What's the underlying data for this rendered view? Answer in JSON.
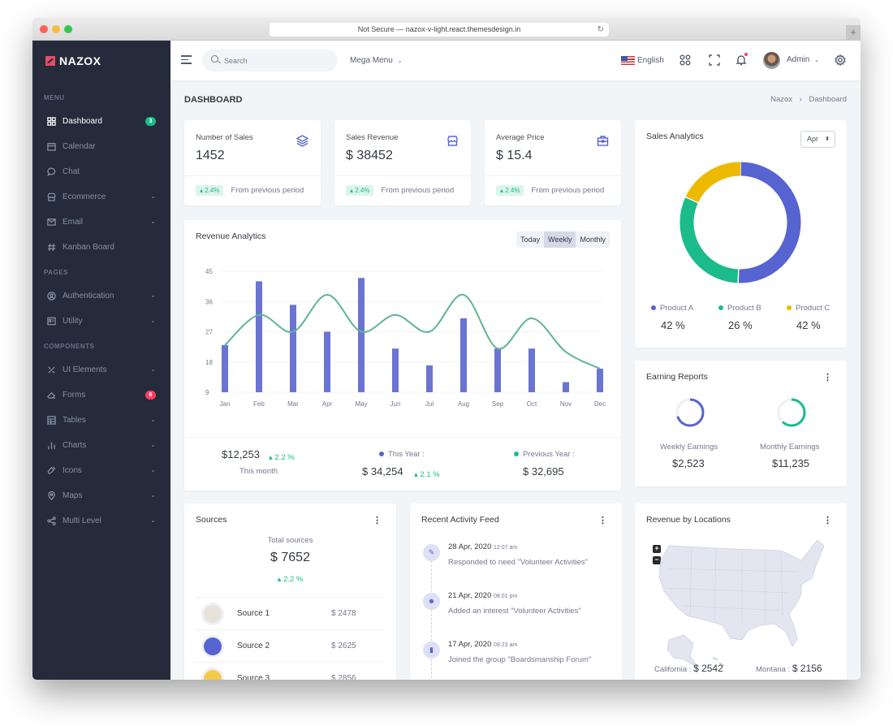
{
  "browser": {
    "url_text": "Not Secure — nazox-v-light.react.themesdesign.in",
    "reload_icon": "reload-icon",
    "new_tab_label": "+"
  },
  "sidebar": {
    "brand": "NAZOX",
    "sections": [
      {
        "title": "MENU"
      },
      {
        "title": "PAGES"
      },
      {
        "title": "COMPONENTS"
      }
    ],
    "items": [
      {
        "label": "Dashboard",
        "icon": "dashboard-icon",
        "badge": "3",
        "active": true
      },
      {
        "label": "Calendar",
        "icon": "calendar-icon"
      },
      {
        "label": "Chat",
        "icon": "chat-icon"
      },
      {
        "label": "Ecommerce",
        "icon": "store-icon",
        "has_children": true
      },
      {
        "label": "Email",
        "icon": "mail-icon",
        "has_children": true
      },
      {
        "label": "Kanban Board",
        "icon": "hashtag-icon"
      },
      {
        "label": "Authentication",
        "icon": "account-circle-icon",
        "has_children": true
      },
      {
        "label": "Utility",
        "icon": "profile-icon",
        "has_children": true
      },
      {
        "label": "UI Elements",
        "icon": "pencil-ruler-icon",
        "has_children": true
      },
      {
        "label": "Forms",
        "icon": "eraser-icon",
        "badge": "6"
      },
      {
        "label": "Tables",
        "icon": "table-icon",
        "has_children": true
      },
      {
        "label": "Charts",
        "icon": "bar-chart-icon",
        "has_children": true
      },
      {
        "label": "Icons",
        "icon": "brush-icon",
        "has_children": true
      },
      {
        "label": "Maps",
        "icon": "map-pin-icon",
        "has_children": true
      },
      {
        "label": "Multi Level",
        "icon": "share-icon",
        "has_children": true
      }
    ]
  },
  "topbar": {
    "search_placeholder": "Search",
    "mega_menu": "Mega Menu",
    "language": "English",
    "user": "Admin"
  },
  "page": {
    "title": "DASHBOARD",
    "breadcrumb": [
      "Nazox",
      "Dashboard"
    ]
  },
  "stats": [
    {
      "label": "Number of Sales",
      "value": "1452",
      "change": "2.4%",
      "change_text": "From previous period",
      "icon": "stack-icon"
    },
    {
      "label": "Sales Revenue",
      "value": "$ 38452",
      "change": "2.4%",
      "change_text": "From previous period",
      "icon": "store-icon"
    },
    {
      "label": "Average Price",
      "value": "$ 15.4",
      "change": "2.4%",
      "change_text": "From previous period",
      "icon": "briefcase-icon"
    }
  ],
  "revenue": {
    "title": "Revenue Analytics",
    "tabs": [
      "Today",
      "Weekly",
      "Monthly"
    ],
    "active_tab": "Weekly",
    "this_month_value": "$12,253",
    "this_month_change": "2.2 %",
    "this_month_label": "This month",
    "this_year_label": "This Year :",
    "this_year_value": "$ 34,254",
    "this_year_change": "2.1 %",
    "prev_year_label": "Previous Year :",
    "prev_year_value": "$ 32,695"
  },
  "chart_data": [
    {
      "type": "bar",
      "title": "Revenue Analytics",
      "categories": [
        "Jan",
        "Feb",
        "Mar",
        "Apr",
        "May",
        "Jun",
        "Jul",
        "Aug",
        "Sep",
        "Oct",
        "Nov",
        "Dec"
      ],
      "series": [
        {
          "name": "This Year",
          "type": "bar",
          "color": "#5664d2",
          "values": [
            23,
            42,
            35,
            27,
            43,
            22,
            17,
            31,
            22,
            22,
            12,
            16
          ]
        },
        {
          "name": "Previous Year",
          "type": "line",
          "color": "#1cbb8c",
          "values": [
            23,
            32,
            27,
            38,
            27,
            32,
            27,
            38,
            22,
            31,
            21,
            16
          ]
        }
      ],
      "yticks": [
        9,
        18,
        27,
        36,
        45
      ],
      "ylim": [
        9,
        45
      ],
      "grid": true,
      "xlabel": "",
      "ylabel": ""
    },
    {
      "type": "pie",
      "title": "Sales Analytics",
      "donut": true,
      "labels": [
        "Product A",
        "Product B",
        "Product C"
      ],
      "values": [
        42,
        26,
        15
      ],
      "colors": [
        "#5664d2",
        "#1cbb8c",
        "#eeb902"
      ],
      "legend_labels": [
        "42 %",
        "26 %",
        "42 %"
      ],
      "legend": "bottom"
    }
  ],
  "sales_analytics": {
    "title": "Sales Analytics",
    "month": "Apr",
    "legend": [
      {
        "label": "Product A",
        "value": "42 %",
        "color": "#5664d2"
      },
      {
        "label": "Product B",
        "value": "26 %",
        "color": "#1cbb8c"
      },
      {
        "label": "Product C",
        "value": "42 %",
        "color": "#eeb902"
      }
    ]
  },
  "earning": {
    "title": "Earning Reports",
    "weekly": {
      "label": "Weekly Earnings",
      "value": "$2,523",
      "progress": 0.7,
      "color": "#5664d2"
    },
    "monthly": {
      "label": "Monthly Earnings",
      "value": "$11,235",
      "progress": 0.62,
      "color": "#1cbb8c"
    }
  },
  "sources": {
    "title": "Sources",
    "total_label": "Total sources",
    "total_value": "$ 7652",
    "change": "2.2 %",
    "rows": [
      {
        "name": "Source 1",
        "value": "$ 2478",
        "color": "#e8e3d8"
      },
      {
        "name": "Source 2",
        "value": "$ 2625",
        "color": "#5664d2"
      },
      {
        "name": "Source 3",
        "value": "$ 2856",
        "color": "#f5c94b"
      }
    ]
  },
  "activity": {
    "title": "Recent Activity Feed",
    "items": [
      {
        "date": "28 Apr, 2020",
        "time": "12:07 am",
        "text": "Responded to need \"Volunteer Activities\"",
        "icon": "edit-icon"
      },
      {
        "date": "21 Apr, 2020",
        "time": "08:01 pm",
        "text": "Added an interest \"Volunteer Activities\"",
        "icon": "user-icon"
      },
      {
        "date": "17 Apr, 2020",
        "time": "09:23 am",
        "text": "Joined the group \"Boardsmanship Forum\"",
        "icon": "bar-chart-icon"
      }
    ]
  },
  "locations": {
    "title": "Revenue by Locations",
    "zoom_in": "+",
    "zoom_out": "−",
    "items": [
      {
        "label": "California :",
        "value": "$ 2542"
      },
      {
        "label": "Montana :",
        "value": "$ 2156"
      }
    ]
  }
}
